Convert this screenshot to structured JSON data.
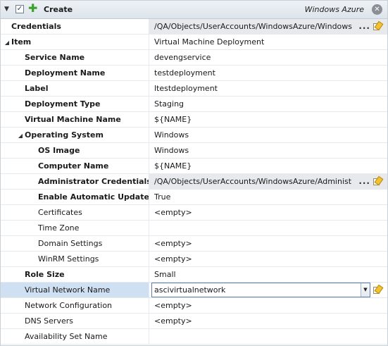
{
  "header": {
    "title": "Create",
    "provider": "Windows Azure"
  },
  "rows": [
    {
      "label": "Credentials",
      "value": "/QA/Objects/UserAccounts/WindowsAzure/Windows"
    },
    {
      "label": "Item",
      "value": "Virtual Machine Deployment"
    },
    {
      "label": "Service Name",
      "value": "devengservice"
    },
    {
      "label": "Deployment Name",
      "value": "testdeployment"
    },
    {
      "label": "Label",
      "value": "ltestdeployment"
    },
    {
      "label": "Deployment Type",
      "value": "Staging"
    },
    {
      "label": "Virtual Machine Name",
      "value": "${NAME}"
    },
    {
      "label": "Operating System",
      "value": "Windows"
    },
    {
      "label": "OS Image",
      "value": "Windows"
    },
    {
      "label": "Computer Name",
      "value": "${NAME}"
    },
    {
      "label": "Administrator Credentials",
      "value": "/QA/Objects/UserAccounts/WindowsAzure/Administ"
    },
    {
      "label": "Enable Automatic Updates",
      "value": "True"
    },
    {
      "label": "Certificates",
      "value": "<empty>"
    },
    {
      "label": "Time Zone",
      "value": ""
    },
    {
      "label": "Domain Settings",
      "value": "<empty>"
    },
    {
      "label": "WinRM Settings",
      "value": "<empty>"
    },
    {
      "label": "Role Size",
      "value": "Small"
    },
    {
      "label": "Virtual Network Name",
      "value": "ascivirtualnetwork"
    },
    {
      "label": "Network Configuration",
      "value": "<empty>"
    },
    {
      "label": "DNS Servers",
      "value": "<empty>"
    },
    {
      "label": "Availability Set Name",
      "value": ""
    }
  ],
  "ellipsis": "...",
  "icons": {
    "collapse": "collapse-triangle-icon",
    "checkbox": "checkbox-icon",
    "add": "plus-icon",
    "close": "close-icon",
    "edit": "edit-pencil-icon",
    "dropdown": "dropdown-arrow-icon"
  },
  "colors": {
    "selected_row": "#cfe0f2",
    "add_icon": "#3aa12b",
    "readonly_value": "#e7e9ec"
  }
}
